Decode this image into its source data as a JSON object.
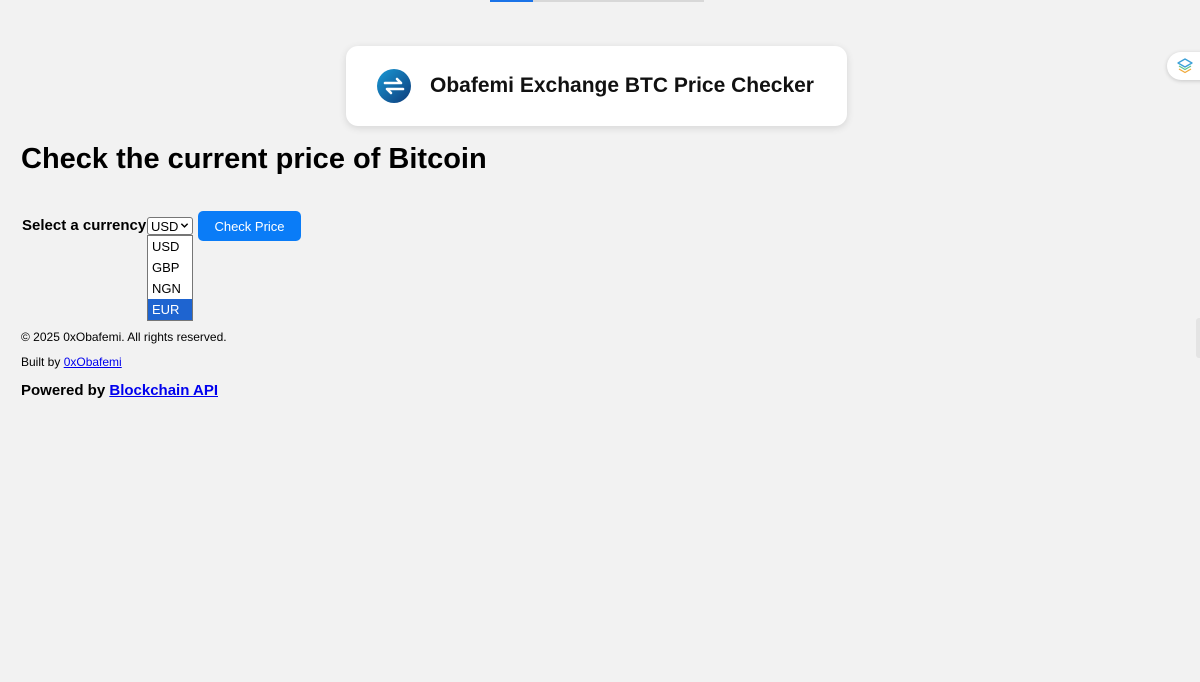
{
  "header": {
    "title": "Obafemi Exchange BTC Price Checker",
    "logo_icon": "exchange-arrows-icon"
  },
  "main": {
    "heading": "Check the current price of Bitcoin",
    "currency_label": "Select a currency:",
    "select": {
      "value": "USD",
      "options": [
        "USD",
        "GBP",
        "NGN",
        "EUR"
      ],
      "highlighted": "EUR"
    },
    "check_button_label": "Check Price"
  },
  "footer": {
    "copyright": "© 2025 0xObafemi. All rights reserved.",
    "built_by_prefix": "Built by ",
    "built_by_link": "0xObafemi",
    "powered_prefix": "Powered by ",
    "powered_link": "Blockchain API"
  },
  "colors": {
    "background": "#f2f2f2",
    "button": "#0a7cf7",
    "selected_option": "#1e64d0",
    "link": "#0000ee"
  },
  "side_widget": {
    "icon": "layers-icon"
  }
}
